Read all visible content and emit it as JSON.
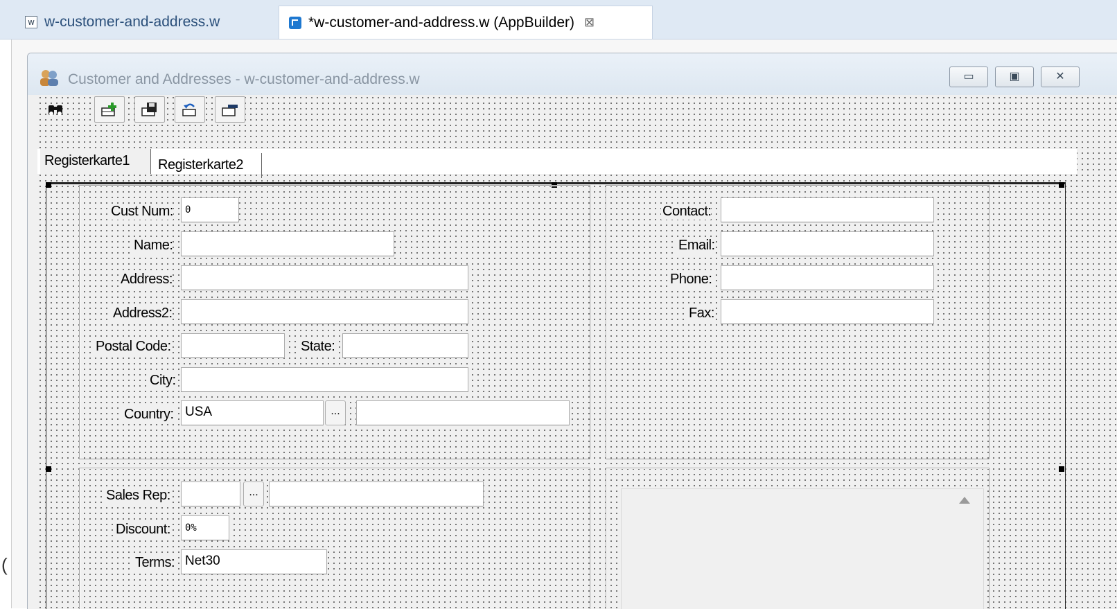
{
  "editor_tabs": [
    {
      "label": "w-customer-and-address.w",
      "icon": "w-file-icon"
    },
    {
      "label": "*w-customer-and-address.w (AppBuilder)",
      "icon": "appbuilder-icon",
      "close": "⊠"
    }
  ],
  "window": {
    "title": "Customer and Addresses - w-customer-and-address.w",
    "minimize": "▭",
    "maximize": "▣",
    "close": "✕"
  },
  "toolbar": [
    "binoculars-icon",
    "add-record-icon",
    "save-record-icon",
    "undo-record-icon",
    "delete-record-icon"
  ],
  "frame_tabs": [
    "Registerkarte1",
    "Registerkarte2"
  ],
  "customer": {
    "cust_num_label": "Cust Num:",
    "cust_num_value": "0",
    "name_label": "Name:",
    "name_value": "",
    "address_label": "Address:",
    "address_value": "",
    "address2_label": "Address2:",
    "address2_value": "",
    "postal_code_label": "Postal Code:",
    "postal_code_value": "",
    "state_label": "State:",
    "state_value": "",
    "city_label": "City:",
    "city_value": "",
    "country_label": "Country:",
    "country_value": "USA",
    "country_desc": "",
    "lookup_label": "..."
  },
  "contact": {
    "contact_label": "Contact:",
    "contact_value": "",
    "email_label": "Email:",
    "email_value": "",
    "phone_label": "Phone:",
    "phone_value": "",
    "fax_label": "Fax:",
    "fax_value": ""
  },
  "sales": {
    "sales_rep_label": "Sales Rep:",
    "sales_rep_value": "",
    "sales_rep_desc": "",
    "discount_label": "Discount:",
    "discount_value": "0%",
    "terms_label": "Terms:",
    "terms_value": "Net30"
  },
  "stray_char": "("
}
